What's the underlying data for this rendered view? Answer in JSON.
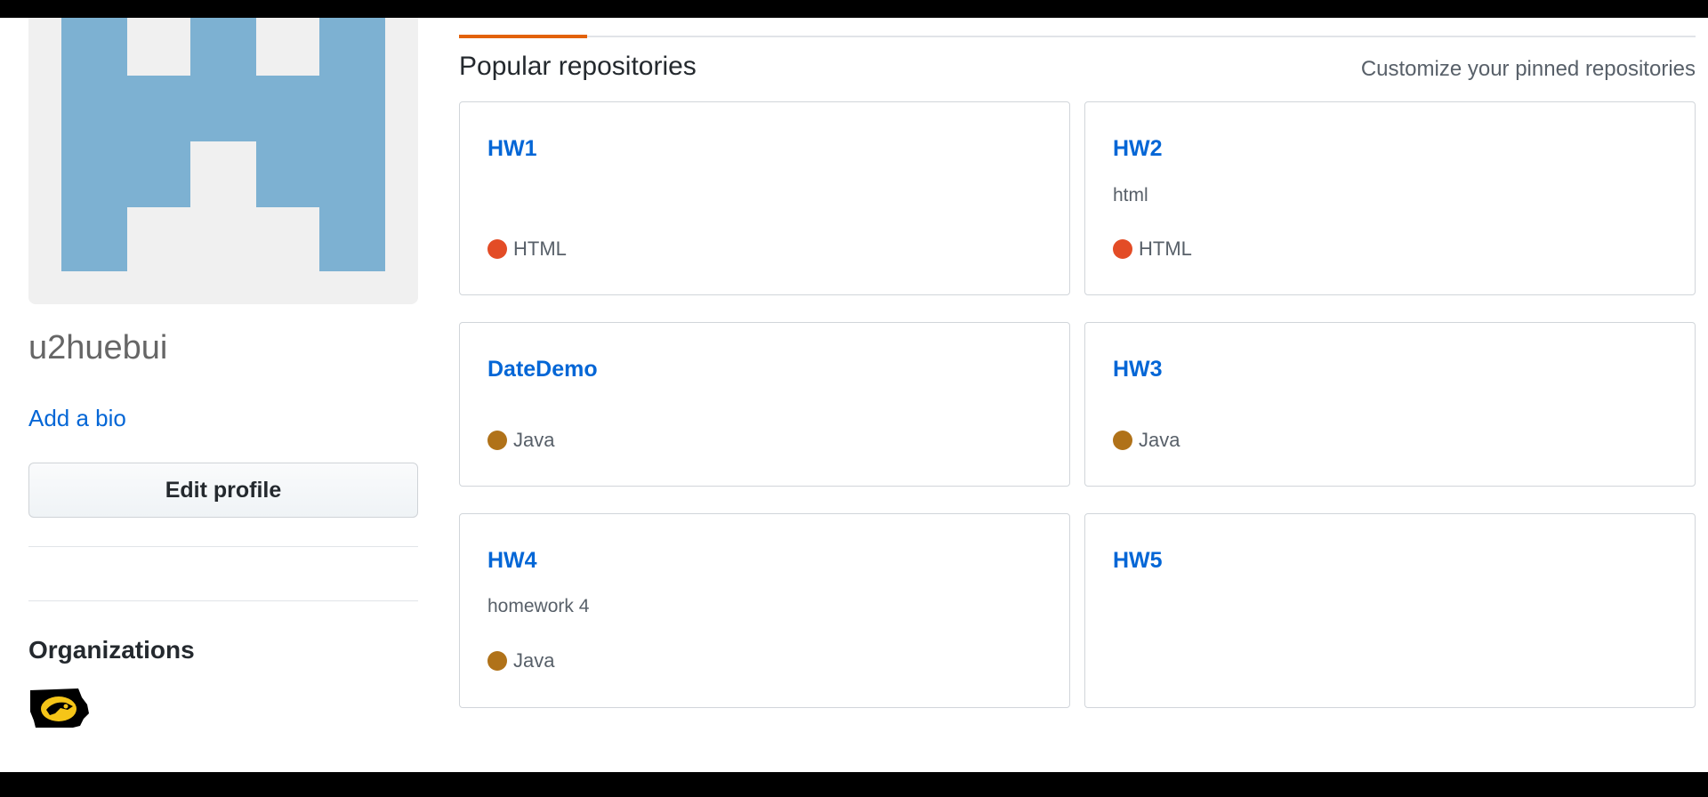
{
  "profile": {
    "username": "u2huebui",
    "add_bio_label": "Add a bio",
    "edit_profile_label": "Edit profile",
    "organizations_title": "Organizations",
    "identicon_color": "#7db1d2"
  },
  "main": {
    "section_title": "Popular repositories",
    "customize_label": "Customize your pinned repositories"
  },
  "repos": [
    {
      "name": "HW1",
      "description": "",
      "language": "HTML",
      "lang_color": "#e34c26"
    },
    {
      "name": "HW2",
      "description": "html",
      "language": "HTML",
      "lang_color": "#e34c26"
    },
    {
      "name": "DateDemo",
      "description": "",
      "language": "Java",
      "lang_color": "#b07219"
    },
    {
      "name": "HW3",
      "description": "",
      "language": "Java",
      "lang_color": "#b07219"
    },
    {
      "name": "HW4",
      "description": "homework 4",
      "language": "Java",
      "lang_color": "#b07219"
    },
    {
      "name": "HW5",
      "description": "",
      "language": "",
      "lang_color": ""
    }
  ]
}
